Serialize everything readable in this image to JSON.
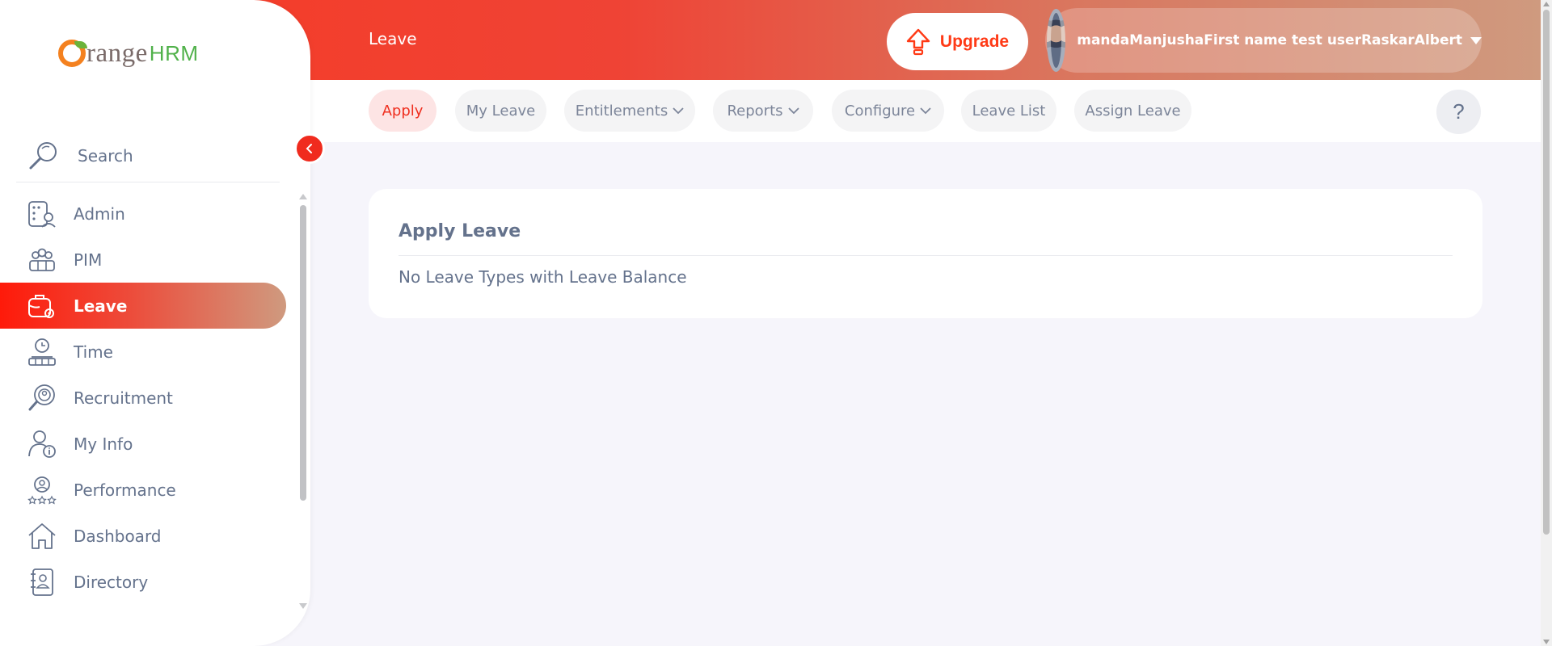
{
  "header": {
    "page_title": "Leave",
    "upgrade_label": "Upgrade",
    "user_name": "mandaManjushaFirst name test userRaskarAlbert"
  },
  "subnav": {
    "tabs": [
      {
        "label": "Apply",
        "active": true,
        "dropdown": false
      },
      {
        "label": "My Leave",
        "active": false,
        "dropdown": false
      },
      {
        "label": "Entitlements",
        "active": false,
        "dropdown": true
      },
      {
        "label": "Reports",
        "active": false,
        "dropdown": true
      },
      {
        "label": "Configure",
        "active": false,
        "dropdown": true
      },
      {
        "label": "Leave List",
        "active": false,
        "dropdown": false
      },
      {
        "label": "Assign Leave",
        "active": false,
        "dropdown": false
      }
    ],
    "help_label": "?"
  },
  "sidebar": {
    "logo_text": "range",
    "logo_hrm": "HRM",
    "search_label": "Search",
    "items": [
      {
        "label": "Admin",
        "icon": "admin-icon",
        "active": false
      },
      {
        "label": "PIM",
        "icon": "pim-icon",
        "active": false
      },
      {
        "label": "Leave",
        "icon": "leave-icon",
        "active": true
      },
      {
        "label": "Time",
        "icon": "time-icon",
        "active": false
      },
      {
        "label": "Recruitment",
        "icon": "recruitment-icon",
        "active": false
      },
      {
        "label": "My Info",
        "icon": "my-info-icon",
        "active": false
      },
      {
        "label": "Performance",
        "icon": "performance-icon",
        "active": false
      },
      {
        "label": "Dashboard",
        "icon": "dashboard-icon",
        "active": false
      },
      {
        "label": "Directory",
        "icon": "directory-icon",
        "active": false
      }
    ]
  },
  "main": {
    "card_title": "Apply Leave",
    "card_message": "No Leave Types with Leave Balance"
  },
  "colors": {
    "accent": "#ef2f1f",
    "text": "#64728c",
    "background": "#f6f5fb"
  }
}
